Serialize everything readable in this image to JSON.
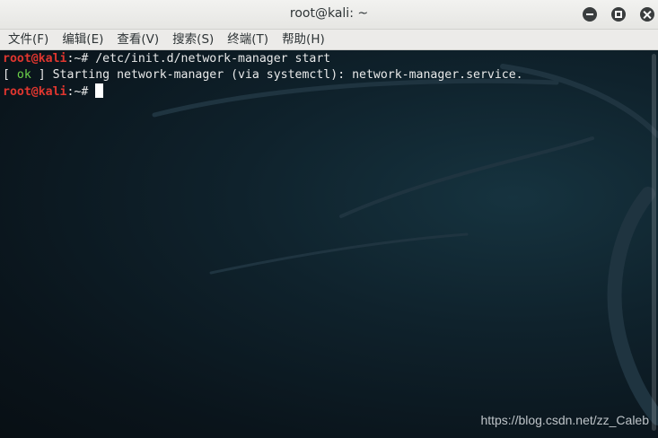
{
  "window": {
    "title": "root@kali: ~"
  },
  "window_controls": {
    "minimize": "minimize-icon",
    "maximize": "maximize-icon",
    "close": "close-icon"
  },
  "menubar": {
    "items": [
      {
        "label": "文件(F)"
      },
      {
        "label": "编辑(E)"
      },
      {
        "label": "查看(V)"
      },
      {
        "label": "搜索(S)"
      },
      {
        "label": "终端(T)"
      },
      {
        "label": "帮助(H)"
      }
    ]
  },
  "terminal": {
    "line1": {
      "user": "root@kali",
      "path": ":~# ",
      "command": "/etc/init.d/network-manager start"
    },
    "line2": {
      "open": "[ ",
      "status": "ok",
      "close": " ] ",
      "message": "Starting network-manager (via systemctl): network-manager.service."
    },
    "line3": {
      "user": "root@kali",
      "path": ":~# "
    }
  },
  "colors": {
    "prompt_user": "#e0362f",
    "ok": "#6cd24a",
    "text": "#e9eaea",
    "background": "#0d1a22"
  },
  "watermark": "https://blog.csdn.net/zz_Caleb"
}
